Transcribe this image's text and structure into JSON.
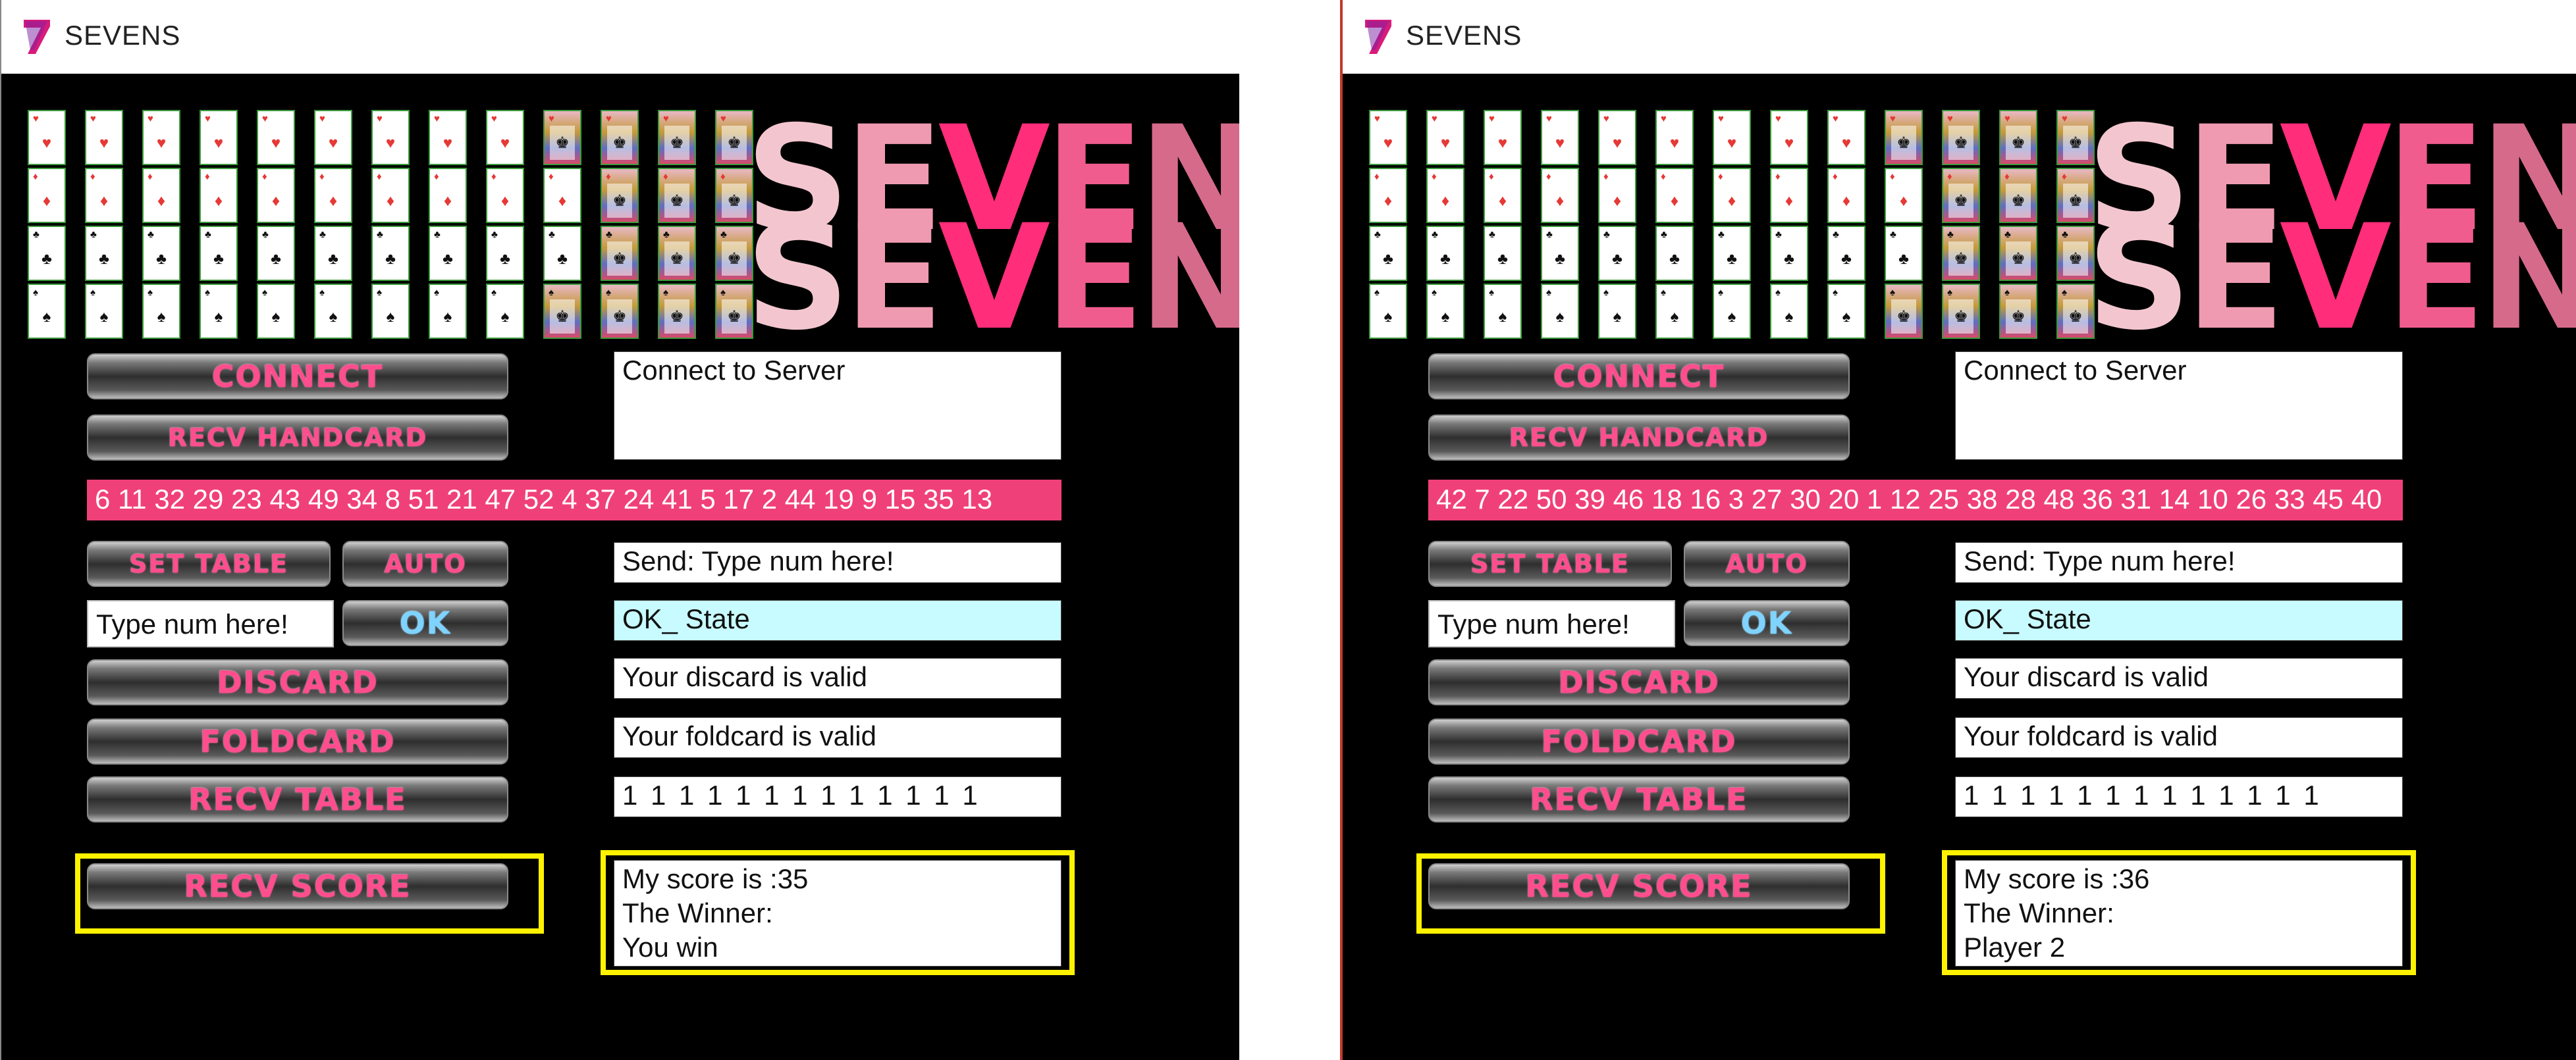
{
  "windows": [
    {
      "title": "SEVENS",
      "logo_text": "SEVENS",
      "connect_label": "CONNECT",
      "recv_handcard_label": "RECV HANDCARD",
      "status": "Connect to Server",
      "hand_cards": "6 11 32 29 23 43 49 34 8 51 21 47 52 4 37 24 41 5 17 2 44 19 9 15 35 13",
      "set_table_label": "SET TABLE",
      "auto_label": "AUTO",
      "send_text": "Send: Type num here!",
      "input_value": "Type num here!",
      "ok_label": "OK",
      "ok_state": "OK_ State",
      "discard_label": "DISCARD",
      "discard_msg": "Your discard is valid",
      "foldcard_label": "FOLDCARD",
      "foldcard_msg": "Your foldcard is valid",
      "recv_table_label": "RECV TABLE",
      "table_values": "1 1 1 1 1 1 1 1 1 1 1 1 1",
      "recv_score_label": "RECV SCORE",
      "score_line1": "My score is :35",
      "score_line2": "The Winner:",
      "score_line3": "You win"
    },
    {
      "title": "SEVENS",
      "logo_text": "SEVENS",
      "connect_label": "CONNECT",
      "recv_handcard_label": "RECV HANDCARD",
      "status": "Connect to Server",
      "hand_cards": "42 7 22 50 39 46 18 16 3 27 30 20 1 12 25 38 28 48 36 31 14 10 26 33 45 40",
      "set_table_label": "SET TABLE",
      "auto_label": "AUTO",
      "send_text": "Send: Type num here!",
      "input_value": "Type num here!",
      "ok_label": "OK",
      "ok_state": "OK_ State",
      "discard_label": "DISCARD",
      "discard_msg": "Your discard is valid",
      "foldcard_label": "FOLDCARD",
      "foldcard_msg": "Your foldcard is valid",
      "recv_table_label": "RECV TABLE",
      "table_values": "1 1 1 1 1 1 1 1 1 1 1 1 1",
      "recv_score_label": "RECV SCORE",
      "score_line1": "My score is :36",
      "score_line2": "The Winner:",
      "score_line3": "Player 2"
    }
  ],
  "colors": {
    "hand_bar": "#f0407a",
    "highlight": "#fff200",
    "ok_state_bg": "#c8fbff"
  }
}
